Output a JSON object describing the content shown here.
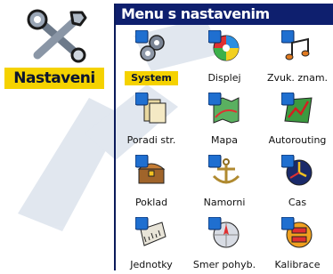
{
  "left_panel": {
    "label": "Nastaveni",
    "icon": "wrench-icon"
  },
  "menu": {
    "title": "Menu s nastavenim",
    "items": [
      {
        "label": "System",
        "icon": "gears-icon",
        "selected": true
      },
      {
        "label": "Displej",
        "icon": "color-wheel-icon",
        "selected": false
      },
      {
        "label": "Zvuk. znam.",
        "icon": "music-note-icon",
        "selected": false
      },
      {
        "label": "Poradi str.",
        "icon": "pages-icon",
        "selected": false
      },
      {
        "label": "Mapa",
        "icon": "map-icon",
        "selected": false
      },
      {
        "label": "Autorouting",
        "icon": "route-icon",
        "selected": false
      },
      {
        "label": "Poklad",
        "icon": "treasure-chest-icon",
        "selected": false
      },
      {
        "label": "Namorni",
        "icon": "anchor-icon",
        "selected": false
      },
      {
        "label": "Cas",
        "icon": "clock-icon",
        "selected": false
      },
      {
        "label": "Jednotky",
        "icon": "ruler-icon",
        "selected": false
      },
      {
        "label": "Smer pohyb.",
        "icon": "compass-icon",
        "selected": false
      },
      {
        "label": "Kalibrace",
        "icon": "calibration-icon",
        "selected": false
      }
    ]
  },
  "colors": {
    "title_bar": "#0e1f6e",
    "selection": "#f5d200",
    "badge": "#1f6fd0"
  }
}
